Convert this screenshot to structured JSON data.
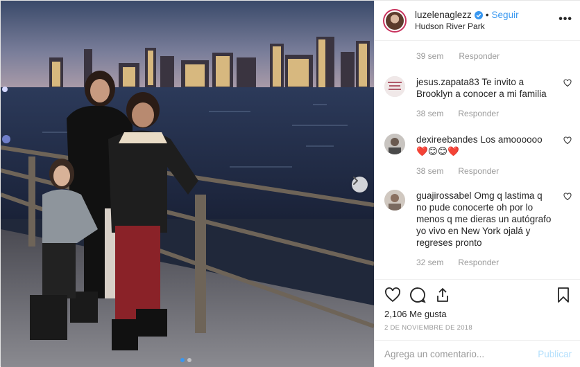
{
  "header": {
    "username": "luzelenaglezz",
    "separator": "•",
    "follow_label": "Seguir",
    "location": "Hudson River Park",
    "more_label": "•••"
  },
  "top_meta": {
    "time": "39 sem",
    "reply": "Responder"
  },
  "comments": [
    {
      "user": "jesus.zapata83",
      "text": "Te invito a Brooklyn a conocer a mi familia",
      "time": "38 sem",
      "reply": "Responder"
    },
    {
      "user": "dexireebandes",
      "text": "Los amoooooo",
      "emojis": "❤️😊😊❤️",
      "time": "38 sem",
      "reply": "Responder"
    },
    {
      "user": "guajirossabel",
      "text": "Omg q lastima q no pude conocerte oh por lo menos q me dieras un autógrafo yo vivo en New York ojalá y regreses pronto",
      "time": "32 sem",
      "reply": "Responder"
    }
  ],
  "actions": {
    "likes": "2,106 Me gusta",
    "date": "2 DE NOVIEMBRE DE 2018"
  },
  "composer": {
    "placeholder": "Agrega un comentario...",
    "publish_label": "Publicar"
  },
  "carousel": {
    "slide_count": 2,
    "active_index": 0
  },
  "colors": {
    "accent": "#3897f0",
    "muted": "#999999",
    "heart_red": "#ed4956",
    "publish_disabled": "#b2dffc"
  }
}
